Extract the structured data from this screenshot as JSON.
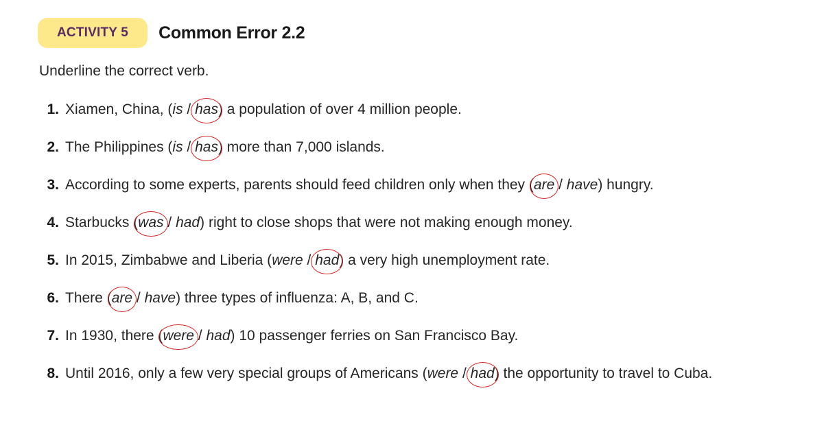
{
  "header": {
    "activity_label": "ACTIVITY 5",
    "title": "Common Error 2.2"
  },
  "instruction": "Underline the correct verb.",
  "items": [
    {
      "num": "1.",
      "before": "Xiamen, China, (",
      "opt1": "is",
      "sep": " / ",
      "opt2": "has",
      "after": ") a population of over 4 million people.",
      "circled": 2
    },
    {
      "num": "2.",
      "before": "The Philippines (",
      "opt1": "is",
      "sep": " / ",
      "opt2": "has",
      "after": ") more than 7,000 islands.",
      "circled": 2
    },
    {
      "num": "3.",
      "before": "According to some experts, parents should feed children only when they (",
      "opt1": "are",
      "sep": " / ",
      "opt2": "have",
      "after": ") hungry.",
      "circled": 1
    },
    {
      "num": "4.",
      "before": "Starbucks (",
      "opt1": "was",
      "sep": " / ",
      "opt2": "had",
      "after": ") right to close shops that were not making enough money.",
      "circled": 1
    },
    {
      "num": "5.",
      "before": "In 2015, Zimbabwe and Liberia (",
      "opt1": "were",
      "sep": " / ",
      "opt2": "had",
      "after": ") a very high unemployment rate.",
      "circled": 2
    },
    {
      "num": "6.",
      "before": "There (",
      "opt1": "are",
      "sep": " / ",
      "opt2": "have",
      "after": ") three types of influenza: A, B, and C.",
      "circled": 1
    },
    {
      "num": "7.",
      "before": "In 1930, there (",
      "opt1": "were",
      "sep": " / ",
      "opt2": "had",
      "after": ") 10 passenger ferries on San Francisco Bay.",
      "circled": 1
    },
    {
      "num": "8.",
      "before": "Until 2016, only a few very special groups of Americans (",
      "opt1": "were",
      "sep": " / ",
      "opt2": "had",
      "after": ") the opportunity to travel to Cuba.",
      "circled": 2
    }
  ],
  "colors": {
    "badge_bg": "#fde98a",
    "badge_text": "#5a2a66",
    "circle": "#d62828"
  }
}
